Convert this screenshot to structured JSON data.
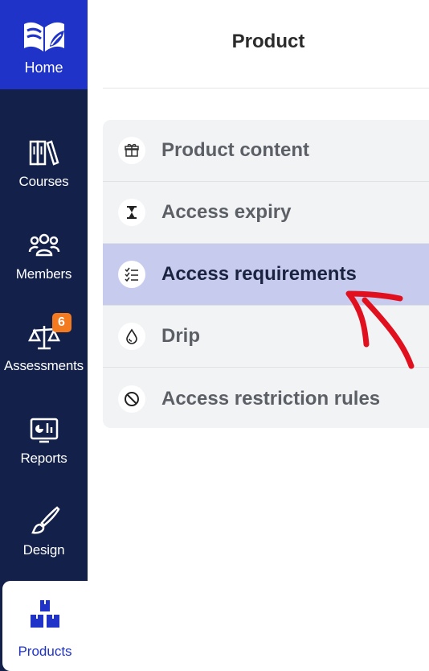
{
  "sidebar": {
    "home": {
      "label": "Home",
      "icon": "book-leaf-logo-icon"
    },
    "items": [
      {
        "label": "Courses",
        "icon": "books-icon"
      },
      {
        "label": "Members",
        "icon": "members-icon"
      },
      {
        "label": "Assessments",
        "icon": "scales-icon",
        "badge": "6"
      },
      {
        "label": "Reports",
        "icon": "reports-icon"
      },
      {
        "label": "Design",
        "icon": "brush-icon"
      },
      {
        "label": "Products",
        "icon": "boxes-icon",
        "active": true
      }
    ]
  },
  "header": {
    "title": "Product"
  },
  "menu": {
    "items": [
      {
        "label": "Product content",
        "icon": "gift-box-icon"
      },
      {
        "label": "Access expiry",
        "icon": "hourglass-icon"
      },
      {
        "label": "Access requirements",
        "icon": "checklist-icon",
        "selected": true
      },
      {
        "label": "Drip",
        "icon": "droplet-icon"
      },
      {
        "label": "Access restriction rules",
        "icon": "no-entry-icon"
      }
    ]
  },
  "annotation": {
    "icon": "red-arrow-icon",
    "color": "#e0101f"
  },
  "colors": {
    "sidebar": "#13214a",
    "accent": "#1f33c8",
    "selected_row": "#c7ccee",
    "badge": "#f47a1f"
  }
}
